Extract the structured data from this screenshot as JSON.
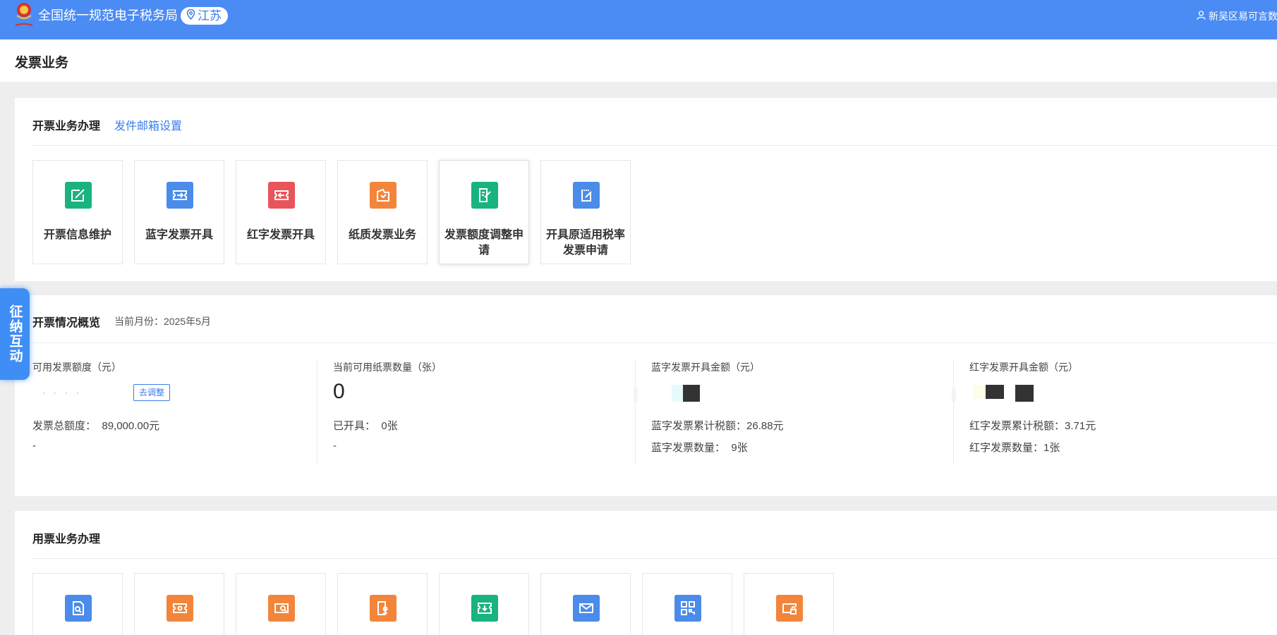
{
  "header": {
    "site_title": "全国统一规范电子税务局",
    "region": "江苏",
    "user": "新吴区易可言数",
    "brand_color": "#4b8bf4"
  },
  "page": {
    "title": "发票业务"
  },
  "issuing": {
    "title": "开票业务办理",
    "link": "发件邮箱设置",
    "tiles": [
      {
        "label": "开票信息维护",
        "icon": "edit-icon",
        "color": "#19b37f"
      },
      {
        "label": "蓝字发票开具",
        "icon": "ticket-in-icon",
        "color": "#4b8bea"
      },
      {
        "label": "红字发票开具",
        "icon": "ticket-out-icon",
        "color": "#e9545b"
      },
      {
        "label": "纸质发票业务",
        "icon": "paper-invoice-icon",
        "color": "#f3853b"
      },
      {
        "label": "发票额度调整申请",
        "icon": "quota-apply-icon",
        "color": "#19b37f"
      },
      {
        "label": "开具原适用税率发票申请",
        "icon": "tax-rate-apply-icon",
        "color": "#4b8bea"
      }
    ]
  },
  "overview": {
    "title": "开票情况概览",
    "month_label": "当前月份：2025年5月",
    "available_quota": {
      "label": "可用发票额度（元）",
      "adjust_btn": "去调整",
      "total_label": "发票总额度：",
      "total_value": "89,000.00元",
      "extra": "-"
    },
    "paper_count": {
      "label": "当前可用纸票数量（张）",
      "value": "0",
      "issued_label": "已开具：",
      "issued_value": "0张",
      "extra": "-"
    },
    "blue_amount": {
      "label": "蓝字发票开具金额（元）",
      "tax_label": "蓝字发票累计税额：",
      "tax_value": "26.88元",
      "count_label": "蓝字发票数量：",
      "count_value": "9张"
    },
    "red_amount": {
      "label": "红字发票开具金额（元）",
      "tax_label": "红字发票累计税额：",
      "tax_value": "3.71元",
      "count_label": "红字发票数量：",
      "count_value": "1张"
    }
  },
  "usage": {
    "title": "用票业务办理",
    "tiles": [
      {
        "icon": "invoice-search-icon",
        "color": "#4b8bea"
      },
      {
        "icon": "ticket-icon",
        "color": "#f3853b"
      },
      {
        "icon": "ticket-search-icon",
        "color": "#f3853b"
      },
      {
        "icon": "invoice-stamp-icon",
        "color": "#f3853b"
      },
      {
        "icon": "invoice-download-icon",
        "color": "#19b37f"
      },
      {
        "icon": "mail-icon",
        "color": "#4b8bea"
      },
      {
        "icon": "qrcode-icon",
        "color": "#4b8bea"
      },
      {
        "icon": "ticket-lock-icon",
        "color": "#f3853b"
      }
    ]
  },
  "side_tab": {
    "label": "征纳互动"
  }
}
